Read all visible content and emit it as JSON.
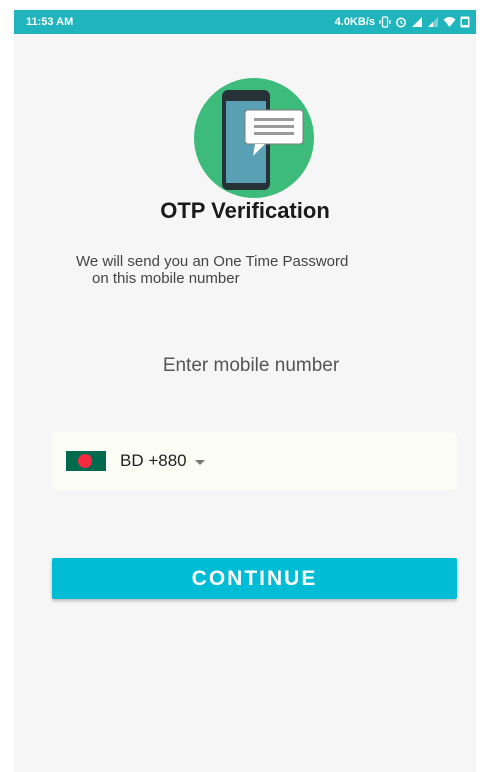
{
  "status_bar": {
    "time": "11:53 AM",
    "net_speed": "4.0KB/s",
    "icons": [
      "vibrate-icon",
      "alarm-icon",
      "signal-icon",
      "signal-weak-icon",
      "wifi-icon",
      "battery-icon"
    ],
    "background": "#20b5bd"
  },
  "header": {
    "illustration": "phone-message-icon",
    "title": "OTP Verification",
    "subtitle_line1": "We will send you an One Time Password",
    "subtitle_line2": "on this mobile number"
  },
  "form": {
    "prompt": "Enter mobile number",
    "country_flag": "bangladesh-flag-icon",
    "country_code": "BD +880",
    "dropdown_icon": "caret-down-icon"
  },
  "actions": {
    "continue_label": "CONTINUE",
    "continue_color": "#00bcd4"
  }
}
